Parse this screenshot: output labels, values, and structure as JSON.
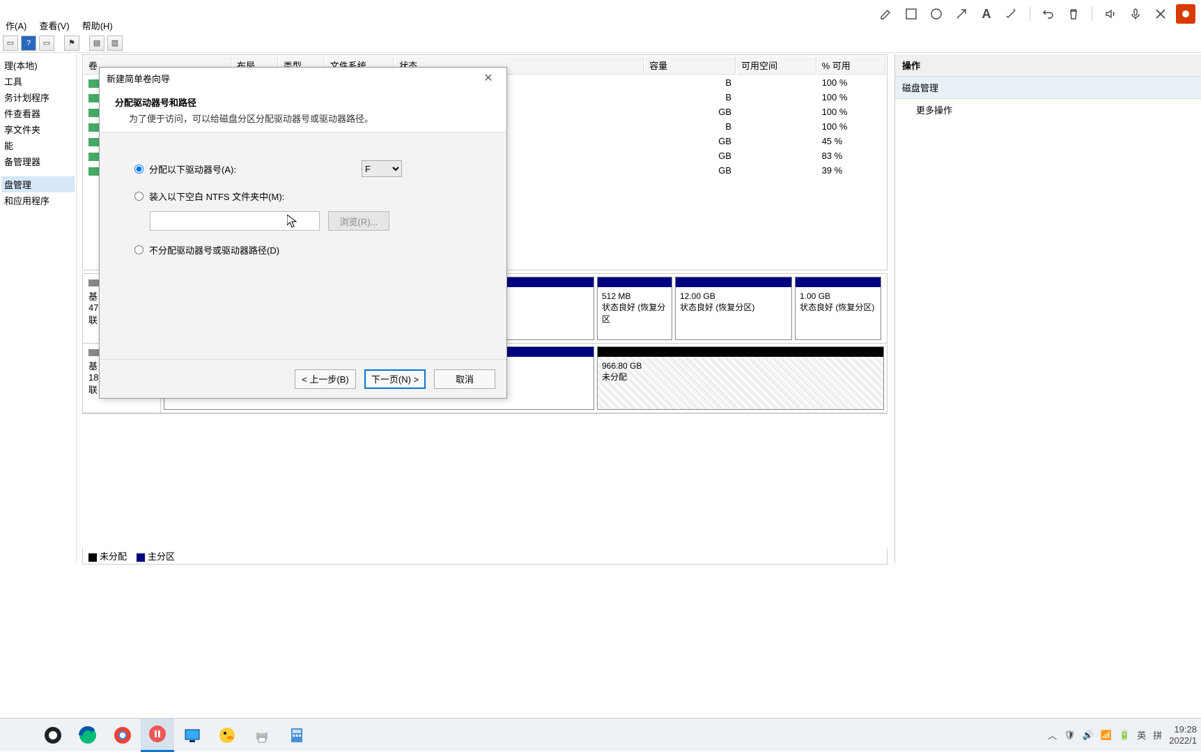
{
  "anno_icons": [
    "pencil",
    "square",
    "circle",
    "arrow",
    "text",
    "wand",
    "undo",
    "trash",
    "speaker",
    "mic",
    "close",
    "rec"
  ],
  "menubar": {
    "items": [
      "作(A)",
      "查看(V)",
      "帮助(H)"
    ]
  },
  "navtree": {
    "items": [
      "理(本地)",
      "工具",
      "务计划程序",
      "件查看器",
      "享文件夹",
      "能",
      "备管理器",
      "盘管理",
      "和应用程序"
    ],
    "selected_index": 7
  },
  "voltable": {
    "headers": [
      "卷",
      "布局",
      "类型",
      "文件系统",
      "状态",
      "容量",
      "可用空间",
      "% 可用"
    ],
    "rows": [
      {
        "cap": "B",
        "pct": "100 %"
      },
      {
        "cap": "B",
        "pct": "100 %"
      },
      {
        "cap": "GB",
        "pct": "100 %"
      },
      {
        "cap": "B",
        "pct": "100 %"
      },
      {
        "cap": "GB",
        "pct": "45 %"
      },
      {
        "cap": "GB",
        "pct": "83 %"
      },
      {
        "cap": "GB",
        "pct": "39 %"
      }
    ]
  },
  "disk0": {
    "label": "基",
    "size": "47",
    "status": "联",
    "parts": [
      {
        "size": "512 MB",
        "status": "状态良好 (恢复分区"
      },
      {
        "size": "12.00 GB",
        "status": "状态良好 (恢复分区)"
      },
      {
        "size": "1.00 GB",
        "status": "状态良好 (恢复分区)"
      }
    ]
  },
  "disk1": {
    "label": "基",
    "size": "18",
    "status": "联",
    "unalloc": {
      "size": "966.80 GB",
      "status": "未分配"
    }
  },
  "legend": {
    "unalloc": "未分配",
    "primary": "主分区"
  },
  "actions": {
    "header": "操作",
    "category": "磁盘管理",
    "more": "更多操作"
  },
  "wizard": {
    "title": "新建简单卷向导",
    "heading": "分配驱动器号和路径",
    "subheading": "为了便于访问，可以给磁盘分区分配驱动器号或驱动器路径。",
    "opt_assign": "分配以下驱动器号(A):",
    "drive_letter": "F",
    "opt_mount": "装入以下空白 NTFS 文件夹中(M):",
    "browse": "浏览(R)...",
    "opt_none": "不分配驱动器号或驱动器路径(D)",
    "btn_back": "< 上一步(B)",
    "btn_next": "下一页(N) >",
    "btn_cancel": "取消"
  },
  "taskbar": {
    "tray": {
      "ime1": "英",
      "ime2": "拼",
      "time": "19:28",
      "date": "2022/1"
    }
  }
}
